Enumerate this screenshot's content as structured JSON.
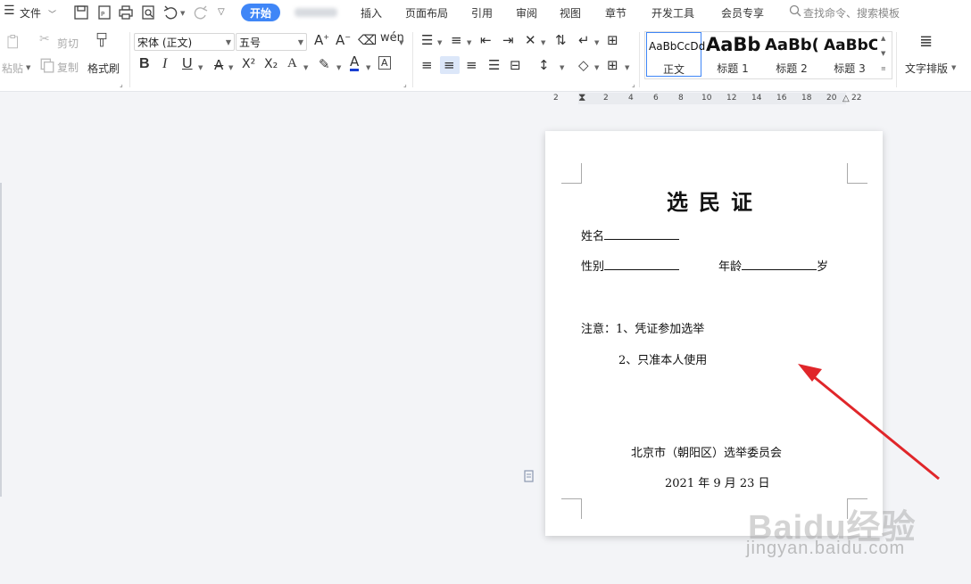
{
  "menu": {
    "file_label": "文件",
    "active_tab": "开始",
    "tabs": [
      "插入",
      "页面布局",
      "引用",
      "审阅",
      "视图",
      "章节",
      "开发工具",
      "会员专享"
    ],
    "search_placeholder": "查找命令、搜索模板"
  },
  "ribbon": {
    "paste": "粘贴",
    "cut": "剪切",
    "copy": "复制",
    "format_painter": "格式刷",
    "font_name": "宋体 (正文)",
    "font_size": "五号",
    "bold": "B",
    "italic": "I",
    "underline": "U",
    "superscript": "X²",
    "subscript": "X₂",
    "styles": [
      {
        "sample": "AaBbCcDd",
        "name": "正文"
      },
      {
        "sample": "AaBb",
        "name": "标题 1"
      },
      {
        "sample": "AaBb(",
        "name": "标题 2"
      },
      {
        "sample": "AaBbC(",
        "name": "标题 3"
      }
    ],
    "text_layout": "文字排版"
  },
  "ruler": {
    "ticks": [
      "2",
      "2",
      "4",
      "6",
      "8",
      "10",
      "12",
      "14",
      "16",
      "18",
      "20",
      "22"
    ]
  },
  "document": {
    "title": "选民证",
    "name_label": "姓名",
    "gender_label": "性别",
    "age_label": "年龄",
    "age_unit": "岁",
    "note_1": "注意：1、凭证参加选举",
    "note_2": "2、只准本人使用",
    "issuer": "北京市（朝阳区）选举委员会",
    "date": "2021 年 9 月 23 日"
  },
  "watermark": {
    "logo": "Baidu经验",
    "url": "jingyan.baidu.com"
  },
  "colors": {
    "accent": "#3f86f7",
    "arrow": "#e0262a"
  }
}
